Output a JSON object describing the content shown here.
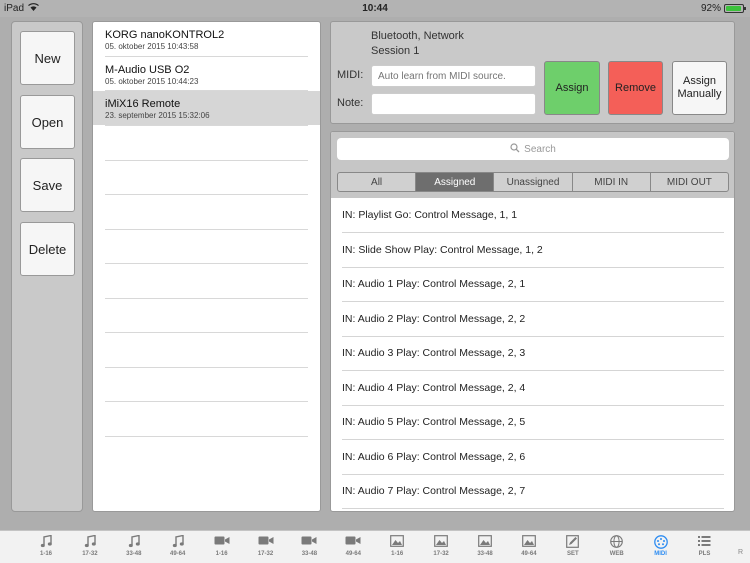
{
  "status": {
    "device": "iPad",
    "time": "10:44",
    "battery": "92%",
    "battery_level": 0.92
  },
  "left_buttons": {
    "new": "New",
    "open": "Open",
    "save": "Save",
    "delete": "Delete"
  },
  "devices": [
    {
      "name": "KORG nanoKONTROL2",
      "date": "05. oktober 2015 10:43:58",
      "selected": false
    },
    {
      "name": "M-Audio USB O2",
      "date": "05. oktober 2015 10:44:23",
      "selected": false
    },
    {
      "name": "iMiX16 Remote",
      "date": "23. september 2015 15:32:06",
      "selected": true
    }
  ],
  "connection": {
    "line1": "Bluetooth, Network",
    "line2": "Session 1"
  },
  "fields": {
    "midi_label": "MIDI:",
    "midi_placeholder": "Auto learn from MIDI source.",
    "note_label": "Note:",
    "note_placeholder": ""
  },
  "actions": {
    "assign": "Assign",
    "remove": "Remove",
    "assign_manually": "Assign Manually"
  },
  "colors": {
    "assign": "#6ecf6b",
    "remove": "#f45f58",
    "tab_active": "#2e8df2"
  },
  "search": {
    "placeholder": "Search"
  },
  "filters": [
    {
      "label": "All",
      "active": false
    },
    {
      "label": "Assigned",
      "active": true
    },
    {
      "label": "Unassigned",
      "active": false
    },
    {
      "label": "MIDI IN",
      "active": false
    },
    {
      "label": "MIDI OUT",
      "active": false
    }
  ],
  "mappings": [
    "IN: Playlist Go: Control Message, 1, 1",
    "IN: Slide Show Play: Control Message, 1, 2",
    "IN: Audio 1 Play: Control Message, 2, 1",
    "IN: Audio 2 Play: Control Message, 2, 2",
    "IN: Audio 3 Play: Control Message, 2, 3",
    "IN: Audio 4 Play: Control Message, 2, 4",
    "IN: Audio 5 Play: Control Message, 2, 5",
    "IN: Audio 6 Play: Control Message, 2, 6",
    "IN: Audio 7 Play: Control Message, 2, 7"
  ],
  "tabs": [
    {
      "icon": "music-note-icon",
      "label": "1-16"
    },
    {
      "icon": "music-note-icon",
      "label": "17-32"
    },
    {
      "icon": "music-note-icon",
      "label": "33-48"
    },
    {
      "icon": "music-note-icon",
      "label": "49-64"
    },
    {
      "icon": "video-camera-icon",
      "label": "1-16"
    },
    {
      "icon": "video-camera-icon",
      "label": "17-32"
    },
    {
      "icon": "video-camera-icon",
      "label": "33-48"
    },
    {
      "icon": "video-camera-icon",
      "label": "49-64"
    },
    {
      "icon": "image-icon",
      "label": "1-16"
    },
    {
      "icon": "image-icon",
      "label": "17-32"
    },
    {
      "icon": "image-icon",
      "label": "33-48"
    },
    {
      "icon": "image-icon",
      "label": "49-64"
    },
    {
      "icon": "edit-icon",
      "label": "SET"
    },
    {
      "icon": "globe-icon",
      "label": "WEB"
    },
    {
      "icon": "midi-icon",
      "label": "MIDI",
      "active": true
    },
    {
      "icon": "list-icon",
      "label": "PLS"
    }
  ],
  "tab_overflow": "R"
}
